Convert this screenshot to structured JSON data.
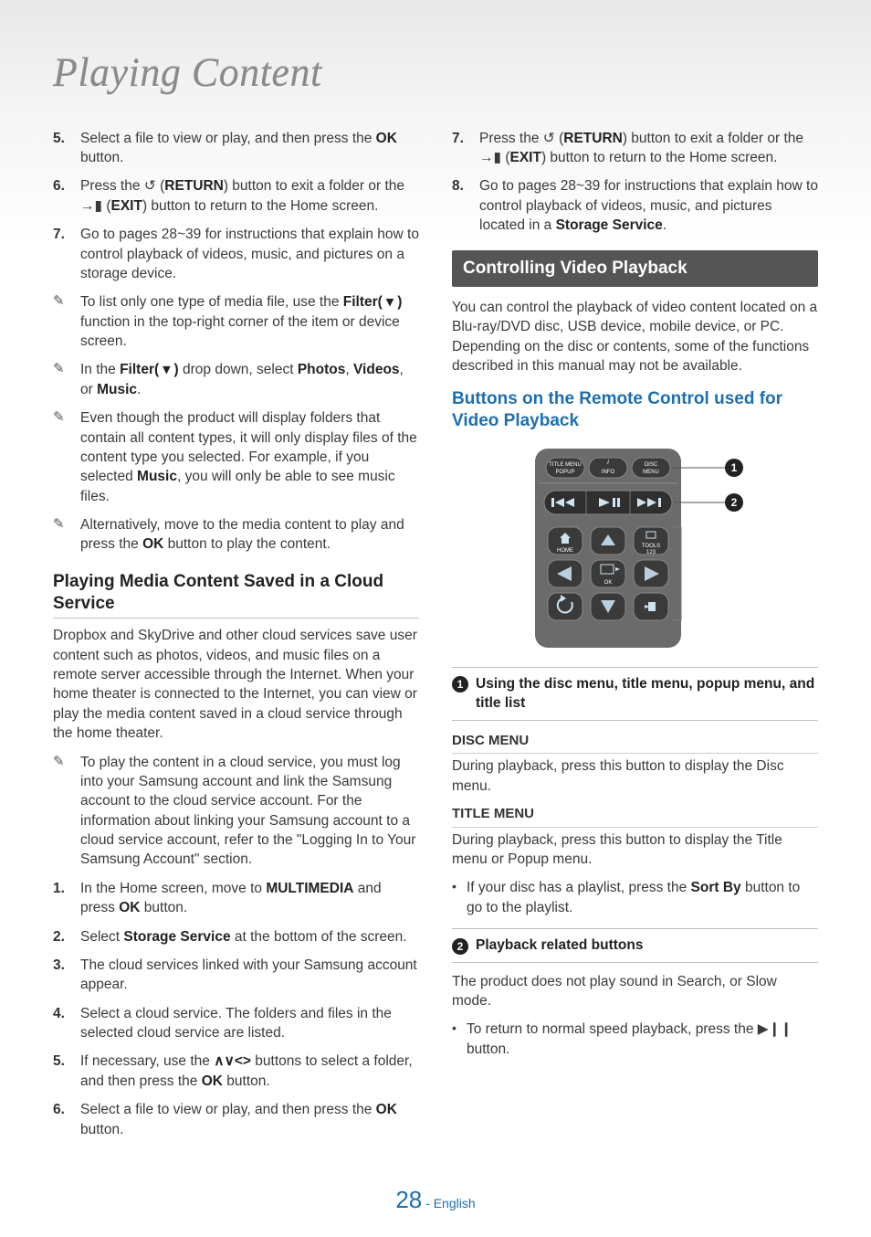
{
  "page_title": "Playing Content",
  "left": {
    "steps_top": [
      {
        "n": "5.",
        "t": "Select a file to view or play, and then press the <b>OK</b> button."
      },
      {
        "n": "6.",
        "t": "Press the ↺ (<b>RETURN</b>) button to exit a folder or the →▮ (<b>EXIT</b>) button to return to the Home screen."
      },
      {
        "n": "7.",
        "t": "Go to pages 28~39 for instructions that explain how to control playback of videos, music, and pictures on a storage device."
      }
    ],
    "bullets": [
      "To list only one type of media file, use the <b>Filter( ▾ )</b> function in the top-right corner of the item or device screen.",
      "In the <b>Filter( ▾ )</b> drop down, select <b>Photos</b>, <b>Videos</b>, or <b>Music</b>.",
      "Even though the product will display folders that contain all content types, it will only display files of the content type you selected. For example, if you selected <b>Music</b>, you will only be  able to see music files.",
      "Alternatively, move to the media content to play and press the <b>OK</b> button to play the content."
    ],
    "cloud_heading": "Playing Media Content Saved in a Cloud Service",
    "cloud_para": "Dropbox and SkyDrive and other cloud services save user content such as photos, videos, and music files on a remote server accessible through the Internet. When your home theater is connected to the Internet, you can view or play the media content saved in a cloud service through the home theater.",
    "cloud_note": "To play the content in a cloud service, you must log into your Samsung account and link the Samsung account to the cloud service account. For the information about linking your Samsung account to a cloud service account, refer to the \"Logging In to Your Samsung Account\" section.",
    "cloud_steps": [
      {
        "n": "1.",
        "t": "In the Home screen, move to <b>MULTIMEDIA</b> and press <b>OK</b> button."
      },
      {
        "n": "2.",
        "t": "Select <b>Storage Service</b> at the bottom of the screen."
      },
      {
        "n": "3.",
        "t": "The cloud services linked with your Samsung account appear."
      },
      {
        "n": "4.",
        "t": "Select a cloud service. The folders and files in the selected cloud service are listed."
      },
      {
        "n": "5.",
        "t": "If necessary, use the <b>∧∨&lt;&gt;</b> buttons to select a folder, and then press the <b>OK</b> button."
      },
      {
        "n": "6.",
        "t": "Select a file to view or play, and then press the <b>OK</b> button."
      }
    ]
  },
  "right": {
    "steps_top": [
      {
        "n": "7.",
        "t": "Press the ↺ (<b>RETURN</b>) button to exit a folder or the →▮ (<b>EXIT</b>) button to return to the Home screen."
      },
      {
        "n": "8.",
        "t": "Go to pages 28~39 for instructions that explain how to control playback of videos, music, and pictures located in a <b>Storage Service</b>."
      }
    ],
    "section_bar": "Controlling Video Playback",
    "section_para": "You can control the playback of video content located on a Blu-ray/DVD disc, USB device, mobile device, or PC. Depending on the disc or contents, some of the functions described in this manual may not be available.",
    "blue_heading": "Buttons on the Remote Control used for Video Playback",
    "remote": {
      "row1": [
        "TITLE MENU\nPOPUP",
        "INFO",
        "DISC\nMENU"
      ],
      "home": "HOME",
      "tools": "TOOLS\n123",
      "ok": "OK",
      "callout1": "1",
      "callout2": "2"
    },
    "legend1_num": "1",
    "legend1_title": "Using the disc menu, title menu, popup menu, and title list",
    "disc_menu_h": "DISC MENU",
    "disc_menu_p": "During playback, press this button to display the Disc menu.",
    "title_menu_h": "TITLE MENU",
    "title_menu_p": "During playback, press this button to display the Title menu or Popup menu.",
    "title_menu_bullet": "If your disc has a playlist, press the <b>Sort By</b> button to go to the playlist.",
    "legend2_num": "2",
    "legend2_title": "Playback related buttons",
    "playback_p": "The product does not play sound in Search, or Slow mode.",
    "playback_bullet": "To return to normal speed playback, press the ▶❙❙ button."
  },
  "footer": {
    "page": "28",
    "lang": "English"
  }
}
